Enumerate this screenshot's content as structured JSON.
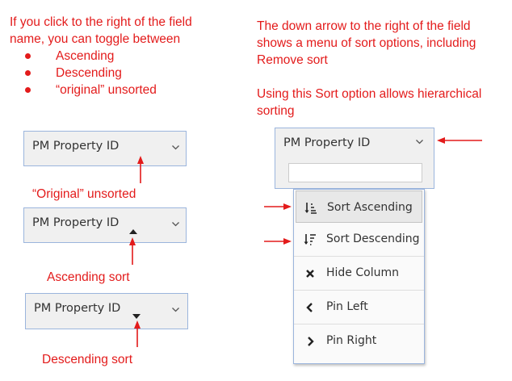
{
  "notes": {
    "left_line1": "If you click to the right of the field",
    "left_line2": "name, you can toggle between",
    "bullets": [
      "Ascending",
      "Descending",
      "“original” unsorted"
    ],
    "right_line1": "The down arrow to the right of the field",
    "right_line2": "shows a menu of sort options, including",
    "right_line3": "Remove sort",
    "right_line4": "Using this Sort option allows hierarchical",
    "right_line5": "sorting"
  },
  "headers": {
    "field_name": "PM Property ID",
    "filter_value": ""
  },
  "annotations": {
    "original": "“Original” unsorted",
    "ascending": "Ascending sort",
    "descending": "Descending sort"
  },
  "menu": {
    "items": [
      {
        "label": "Sort Ascending",
        "icon": "sort-ascending-icon"
      },
      {
        "label": "Sort Descending",
        "icon": "sort-descending-icon"
      },
      {
        "label": "Hide Column",
        "icon": "close-icon"
      },
      {
        "label": "Pin Left",
        "icon": "chevron-left-icon"
      },
      {
        "label": "Pin Right",
        "icon": "chevron-right-icon"
      }
    ]
  },
  "colors": {
    "annotation": "#e31b1b",
    "header_border": "#9bb5dd",
    "header_bg": "#f0f0f0"
  }
}
